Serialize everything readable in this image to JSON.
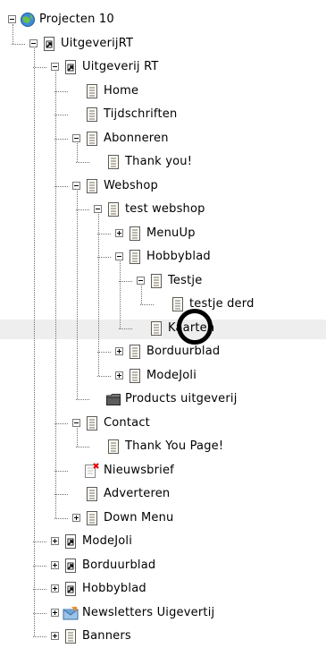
{
  "tree": [
    {
      "label": "Projecten 10",
      "icon": "globe-icon",
      "level": 0,
      "expander": "minus"
    },
    {
      "label": "UitgeverijRT",
      "icon": "site-page-icon",
      "level": 1,
      "expander": "minus"
    },
    {
      "label": "Uitgeverij RT",
      "icon": "site-page-icon",
      "level": 2,
      "expander": "minus"
    },
    {
      "label": "Home",
      "icon": "page-icon",
      "level": 3,
      "expander": "none"
    },
    {
      "label": "Tijdschriften",
      "icon": "page-icon",
      "level": 3,
      "expander": "none"
    },
    {
      "label": "Abonneren",
      "icon": "page-icon",
      "level": 3,
      "expander": "minus"
    },
    {
      "label": "Thank you!",
      "icon": "page-icon",
      "level": 4,
      "expander": "none"
    },
    {
      "label": "Webshop",
      "icon": "page-icon",
      "level": 3,
      "expander": "minus"
    },
    {
      "label": "test webshop",
      "icon": "page-icon",
      "level": 4,
      "expander": "minus"
    },
    {
      "label": "MenuUp",
      "icon": "page-icon",
      "level": 5,
      "expander": "plus"
    },
    {
      "label": "Hobbyblad",
      "icon": "page-icon",
      "level": 5,
      "expander": "minus"
    },
    {
      "label": "Testje",
      "icon": "page-icon",
      "level": 6,
      "expander": "minus"
    },
    {
      "label": "testje derd",
      "icon": "page-icon",
      "level": 7,
      "expander": "none"
    },
    {
      "label": "Kaarten",
      "icon": "page-icon",
      "level": 6,
      "expander": "none",
      "selected": true
    },
    {
      "label": "Borduurblad",
      "icon": "page-icon",
      "level": 5,
      "expander": "plus"
    },
    {
      "label": "ModeJoli",
      "icon": "page-icon",
      "level": 5,
      "expander": "plus"
    },
    {
      "label": "Products uitgeverij",
      "icon": "products-folder-icon",
      "level": 4,
      "expander": "none"
    },
    {
      "label": "Contact",
      "icon": "page-icon",
      "level": 3,
      "expander": "minus"
    },
    {
      "label": "Thank You Page!",
      "icon": "page-icon",
      "level": 4,
      "expander": "none"
    },
    {
      "label": "Nieuwsbrief",
      "icon": "page-error-icon",
      "level": 3,
      "expander": "none"
    },
    {
      "label": "Adverteren",
      "icon": "page-icon",
      "level": 3,
      "expander": "none"
    },
    {
      "label": "Down Menu",
      "icon": "page-icon",
      "level": 3,
      "expander": "plus"
    },
    {
      "label": "ModeJoli",
      "icon": "site-page-icon",
      "level": 2,
      "expander": "plus"
    },
    {
      "label": "Borduurblad",
      "icon": "site-page-icon",
      "level": 2,
      "expander": "plus"
    },
    {
      "label": "Hobbyblad",
      "icon": "site-page-icon",
      "level": 2,
      "expander": "plus"
    },
    {
      "label": "Newsletters Uigevertij",
      "icon": "newsletter-icon",
      "level": 2,
      "expander": "plus"
    },
    {
      "label": "Banners",
      "icon": "page-icon",
      "level": 2,
      "expander": "plus"
    }
  ]
}
